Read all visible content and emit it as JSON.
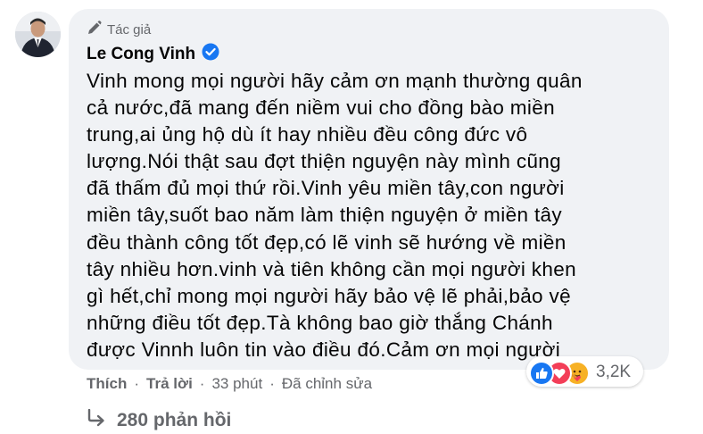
{
  "comment": {
    "author_badge": "Tác giả",
    "author_name": "Le Cong Vinh",
    "text_lines": [
      "Vinh mong mọi người hãy cảm ơn mạnh thường quân",
      "cả nước,đã mang đến niềm vui cho đồng bào miền",
      "trung,ai ủng hộ dù ít hay nhiều đều công đức vô",
      "lượng.Nói thật sau đợt thiện nguyện này mình cũng",
      "đã thấm đủ mọi thứ rồi.Vinh yêu miền tây,con người",
      "miền tây,suốt bao năm làm thiện nguyện ở miền tây",
      "đều thành công tốt đẹp,có lẽ vinh sẽ hướng về miền",
      "tây nhiều hơn.vinh và tiên không cần mọi người khen",
      "gì hết,chỉ mong mọi người hãy bảo vệ lẽ phải,bảo vệ",
      "những điều tốt đẹp.Tà không bao giờ thắng Chánh",
      "được Vinnh luôn tin vào điều đó.Cảm ơn mọi người"
    ],
    "reactions": {
      "icons": [
        "like-icon",
        "love-icon",
        "care-icon"
      ],
      "count": "3,2K"
    },
    "actions": {
      "like": "Thích",
      "reply": "Trả lời",
      "time": "33 phút",
      "edited": "Đã chỉnh sửa"
    },
    "replies_label": "280 phản hồi"
  },
  "colors": {
    "bubble_bg": "#f0f2f5",
    "secondary_text": "#65676b",
    "verified_blue": "#1877f2",
    "like_blue": "#1877f2",
    "love_red": "#f33e58",
    "care_yellow": "#f7b125"
  }
}
